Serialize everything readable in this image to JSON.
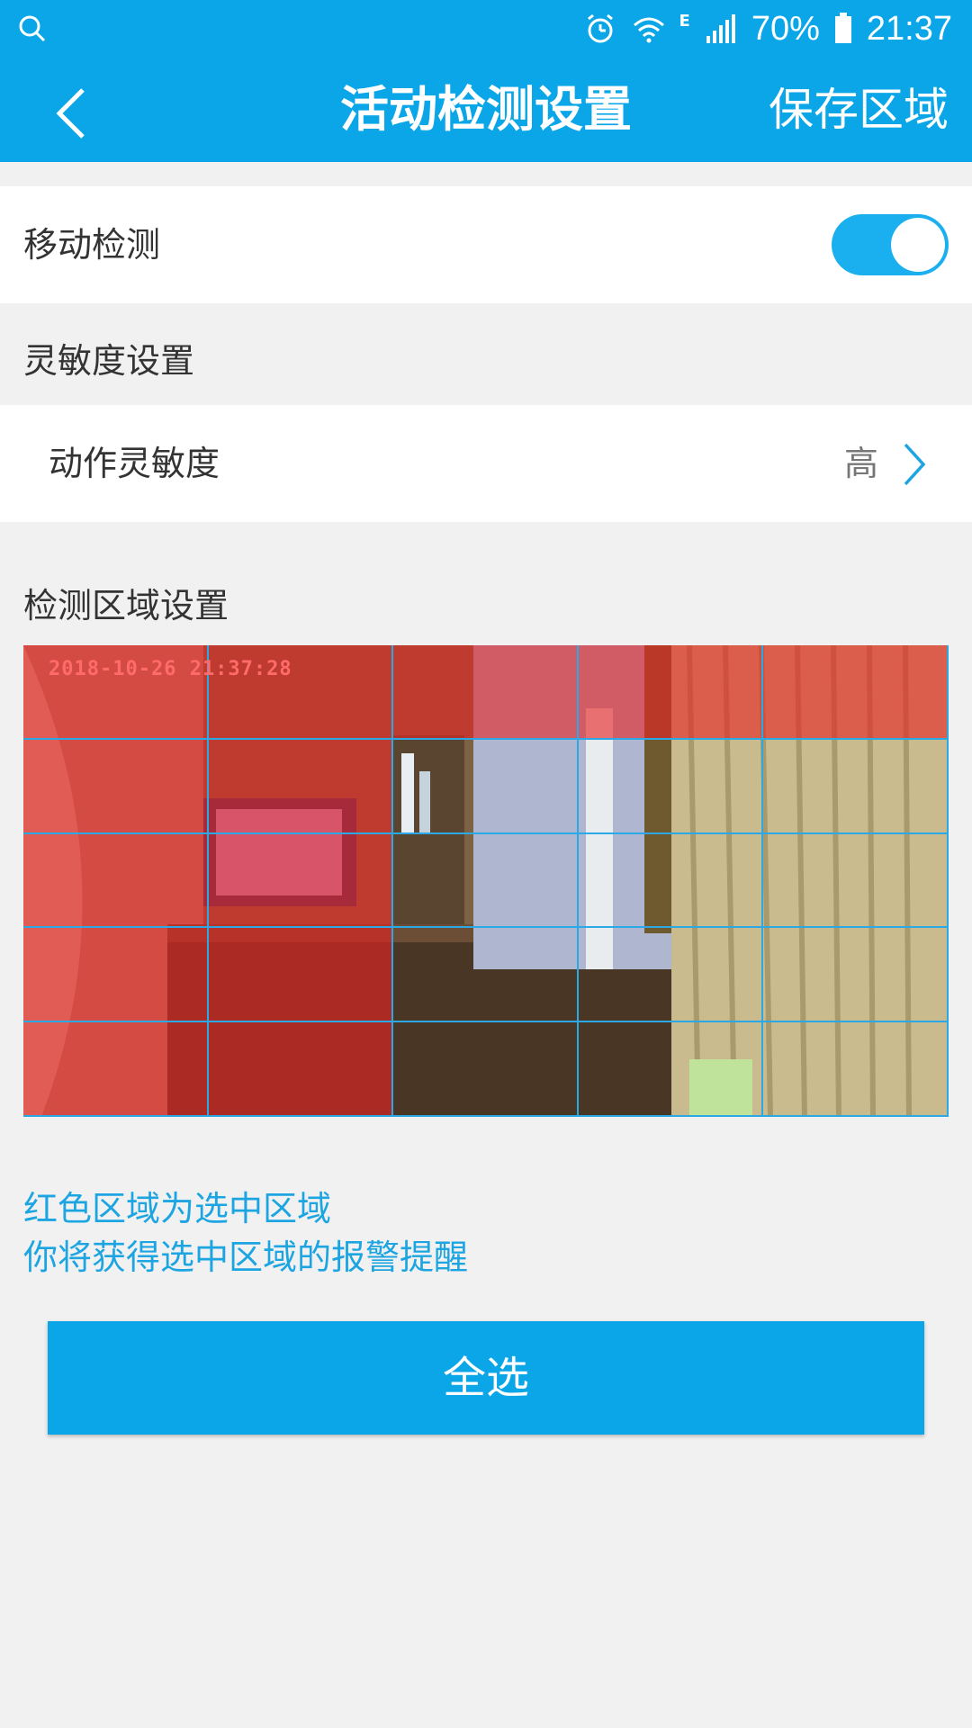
{
  "status_bar": {
    "battery_percent": "70%",
    "time": "21:37",
    "network_type": "E",
    "icons": [
      "search-icon",
      "alarm-icon",
      "wifi-icon",
      "signal-icon",
      "battery-icon"
    ]
  },
  "app_bar": {
    "title": "活动检测设置",
    "save_label": "保存区域"
  },
  "motion_detection": {
    "label": "移动检测",
    "enabled": true
  },
  "sensitivity_section": {
    "title": "灵敏度设置",
    "item_label": "动作灵敏度",
    "item_value": "高"
  },
  "area_section": {
    "title": "检测区域设置",
    "timestamp": "2018-10-26 21:37:28",
    "grid_rows": 5,
    "grid_cols": 5,
    "selected_cells": [
      [
        true,
        true,
        true,
        true,
        true
      ],
      [
        true,
        true,
        false,
        false,
        false
      ],
      [
        true,
        true,
        false,
        false,
        false
      ],
      [
        true,
        true,
        false,
        false,
        false
      ],
      [
        true,
        true,
        false,
        false,
        false
      ]
    ]
  },
  "hint": {
    "line1": "红色区域为选中区域",
    "line2": "你将获得选中区域的报警提醒"
  },
  "select_all_label": "全选",
  "colors": {
    "primary": "#0aa6e8",
    "selected_overlay": "#e62323",
    "hint_text": "#1da5e2"
  }
}
